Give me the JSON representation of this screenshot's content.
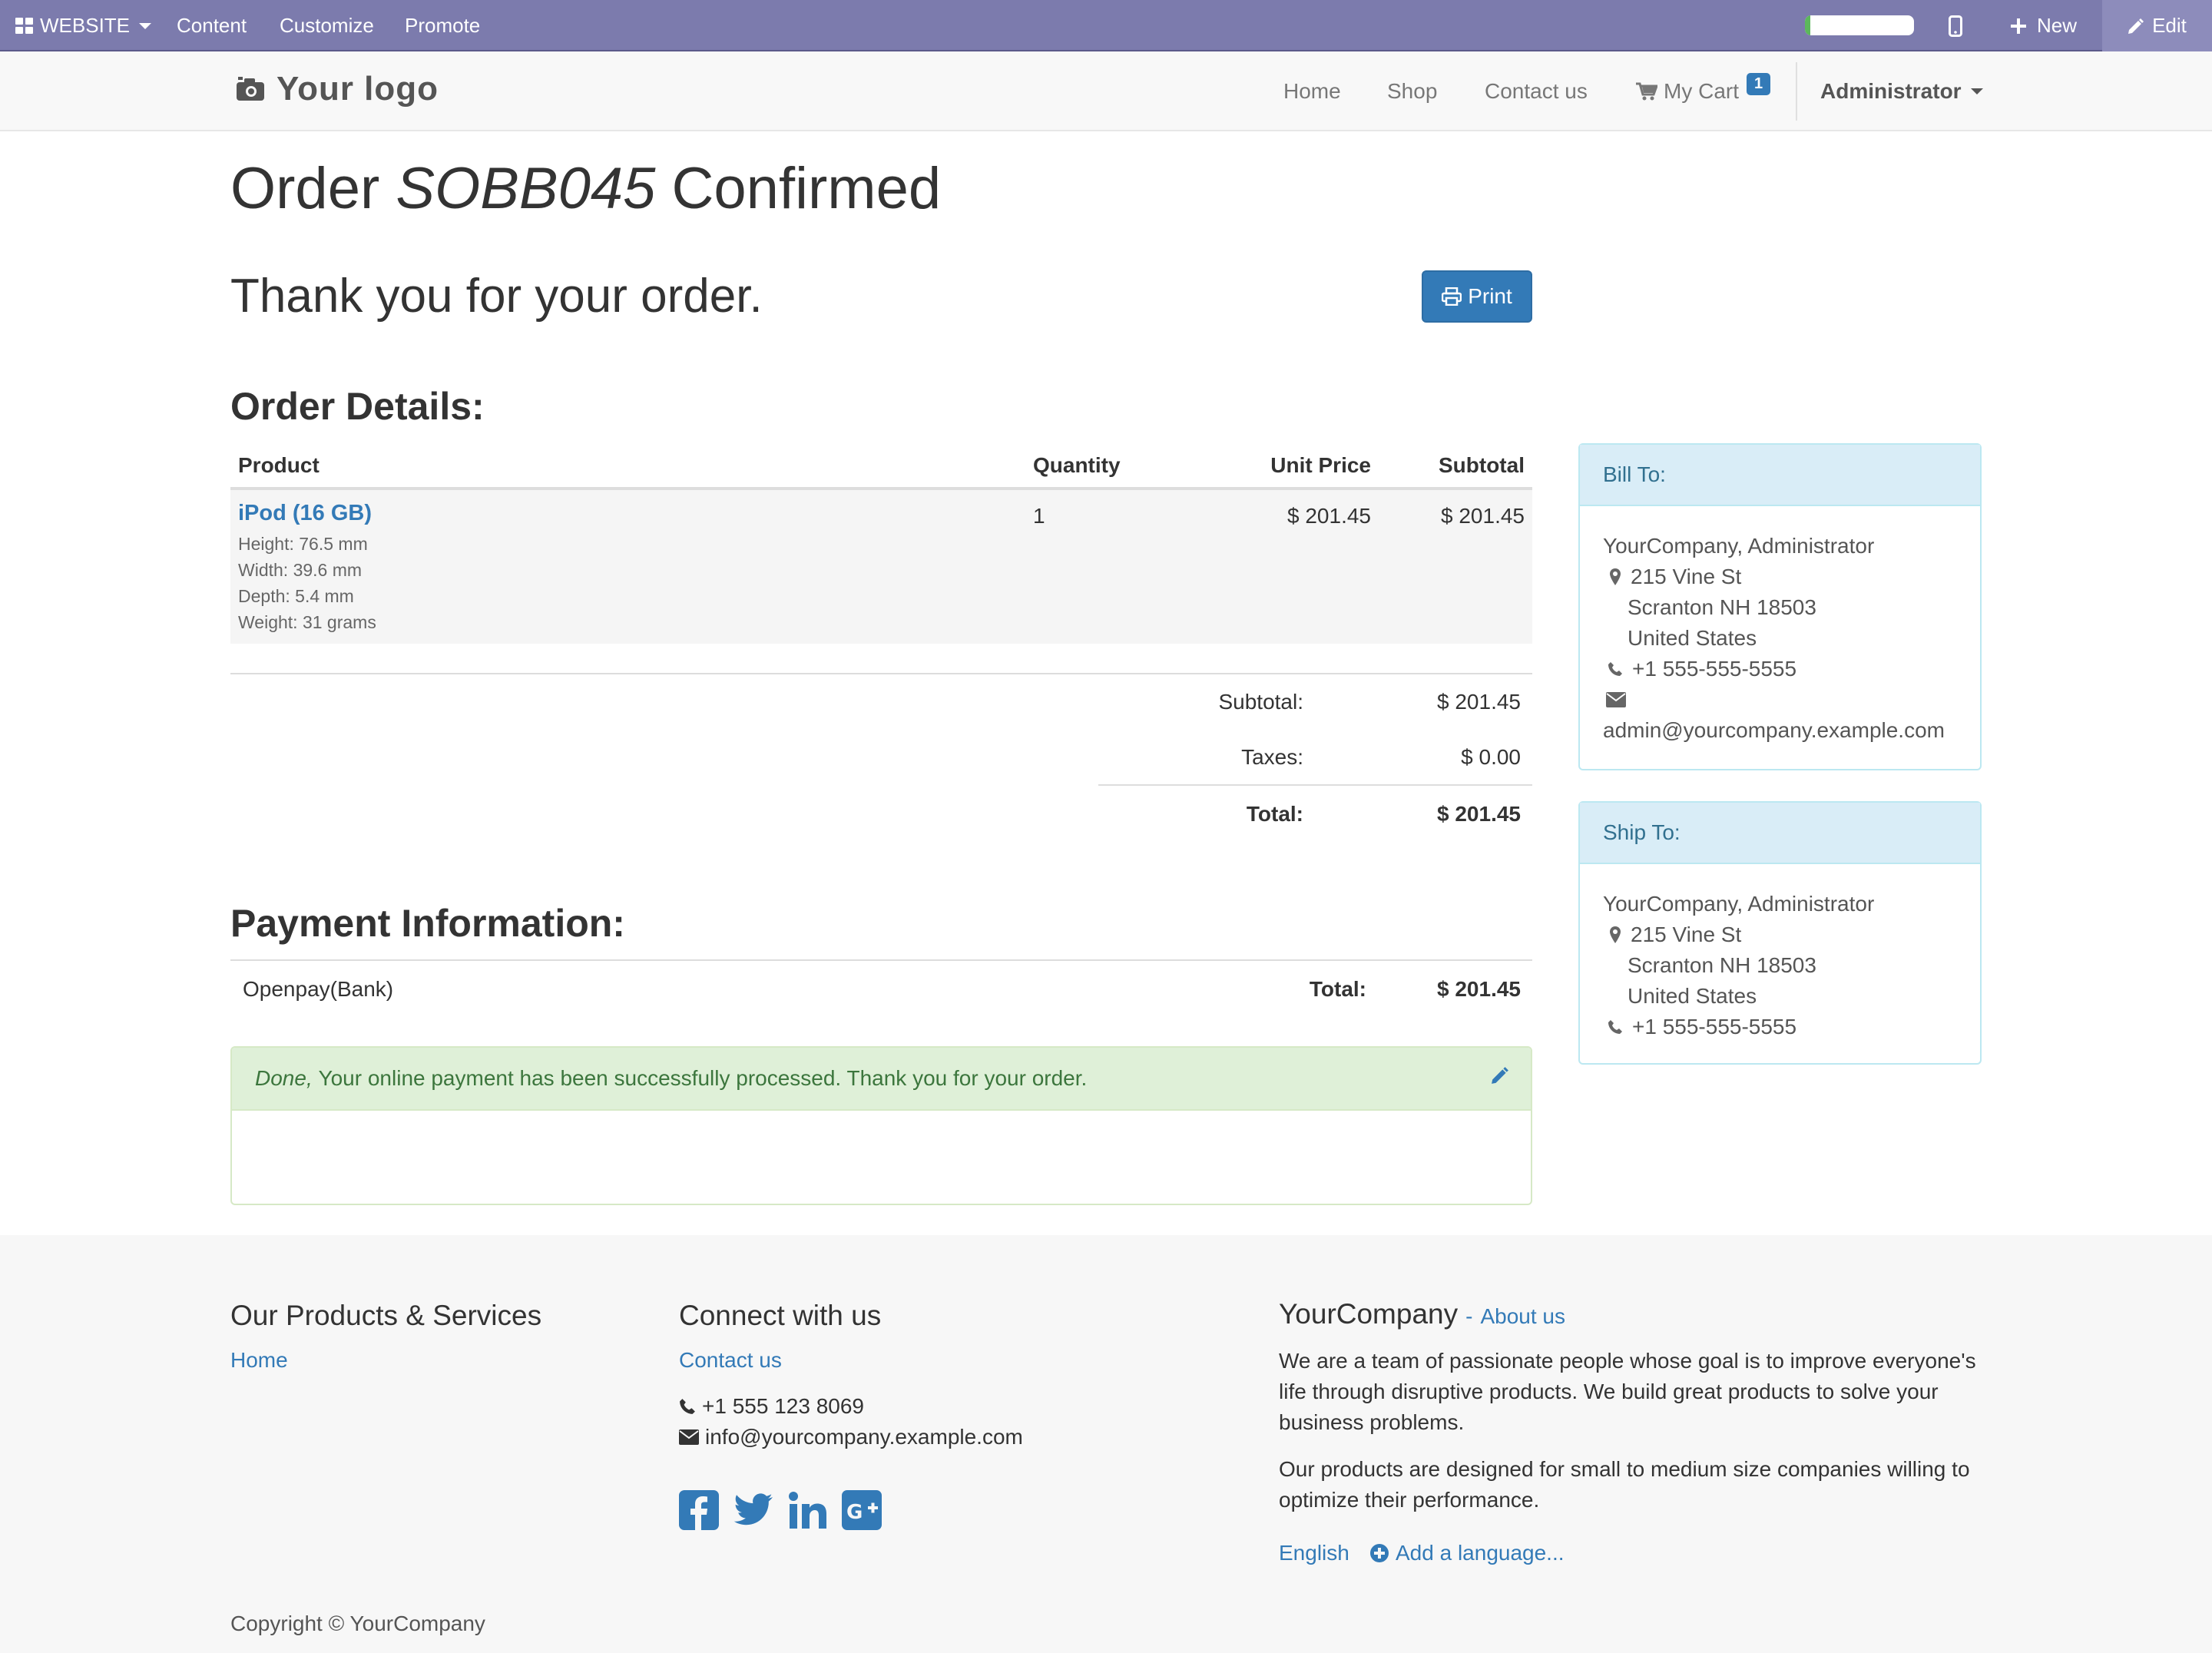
{
  "editbar": {
    "website_label": "WEBSITE",
    "content_label": "Content",
    "customize_label": "Customize",
    "promote_label": "Promote",
    "progress_fraction": 0.05,
    "new_label": "New",
    "edit_label": "Edit",
    "colors": {
      "bar": "#7c7bad",
      "edit_bg": "#8d8cbb"
    }
  },
  "navbar": {
    "logo_text": "Your logo",
    "links": {
      "home": "Home",
      "shop": "Shop",
      "contact": "Contact us",
      "cart": "My Cart"
    },
    "cart_count": "1",
    "user": "Administrator"
  },
  "page": {
    "title_pre": "Order",
    "order_ref": "SOBB045",
    "title_post": "Confirmed",
    "thank_you": "Thank you for your order.",
    "print_label": "Print",
    "order_details_heading": "Order Details:"
  },
  "order_table": {
    "headers": {
      "product": "Product",
      "quantity": "Quantity",
      "unit_price": "Unit Price",
      "subtotal": "Subtotal"
    },
    "rows": [
      {
        "product": "iPod (16 GB)",
        "attributes": [
          "Height: 76.5 mm",
          "Width: 39.6 mm",
          "Depth: 5.4 mm",
          "Weight: 31 grams"
        ],
        "quantity": "1",
        "unit_price": "$ 201.45",
        "subtotal": "$ 201.45"
      }
    ],
    "summary": {
      "subtotal_label": "Subtotal:",
      "subtotal_value": "$ 201.45",
      "taxes_label": "Taxes:",
      "taxes_value": "$ 0.00",
      "total_label": "Total:",
      "total_value": "$ 201.45"
    }
  },
  "payment": {
    "heading": "Payment Information:",
    "method": "Openpay(Bank)",
    "total_label": "Total:",
    "total_value": "$ 201.45",
    "status_emphasis": "Done,",
    "status_message": "Your online payment has been successfully processed. Thank you for your order."
  },
  "bill_to": {
    "heading": "Bill To:",
    "name": "YourCompany, Administrator",
    "street": "215 Vine St",
    "city": "Scranton NH 18503",
    "country": "United States",
    "phone": "+1 555-555-5555",
    "email": "admin@yourcompany.example.com"
  },
  "ship_to": {
    "heading": "Ship To:",
    "name": "YourCompany, Administrator",
    "street": "215 Vine St",
    "city": "Scranton NH 18503",
    "country": "United States",
    "phone": "+1 555-555-5555"
  },
  "footer": {
    "products_heading": "Our Products & Services",
    "products_home": "Home",
    "connect_heading": "Connect with us",
    "connect_contact": "Contact us",
    "phone": "+1 555 123 8069",
    "email": "info@yourcompany.example.com",
    "company_name": "YourCompany",
    "about_sep": "-",
    "about_link": "About us",
    "about_p1": "We are a team of passionate people whose goal is to improve everyone's life through disruptive products. We build great products to solve your business problems.",
    "about_p2": "Our products are designed for small to medium size companies willing to optimize their performance.",
    "language": "English",
    "add_language": "Add a language...",
    "copyright": "Copyright © YourCompany"
  }
}
